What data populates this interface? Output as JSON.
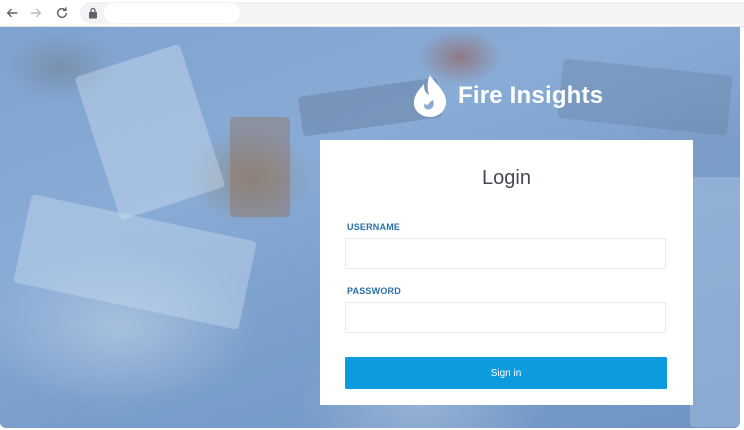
{
  "browser": {
    "icons": [
      "back-arrow-icon",
      "forward-arrow-icon",
      "reload-icon",
      "lock-icon"
    ]
  },
  "brand": {
    "name": "Fire Insights",
    "logo_icon": "flame-icon",
    "logo_color": "#ffffff"
  },
  "login": {
    "title": "Login",
    "username_label": "USERNAME",
    "username_value": "",
    "password_label": "PASSWORD",
    "password_value": "",
    "signin_label": "Sign in"
  },
  "colors": {
    "accent": "#0d9be0",
    "label": "#2a6fa8",
    "title": "#444a52",
    "background_tint": "#7fa3cf"
  }
}
